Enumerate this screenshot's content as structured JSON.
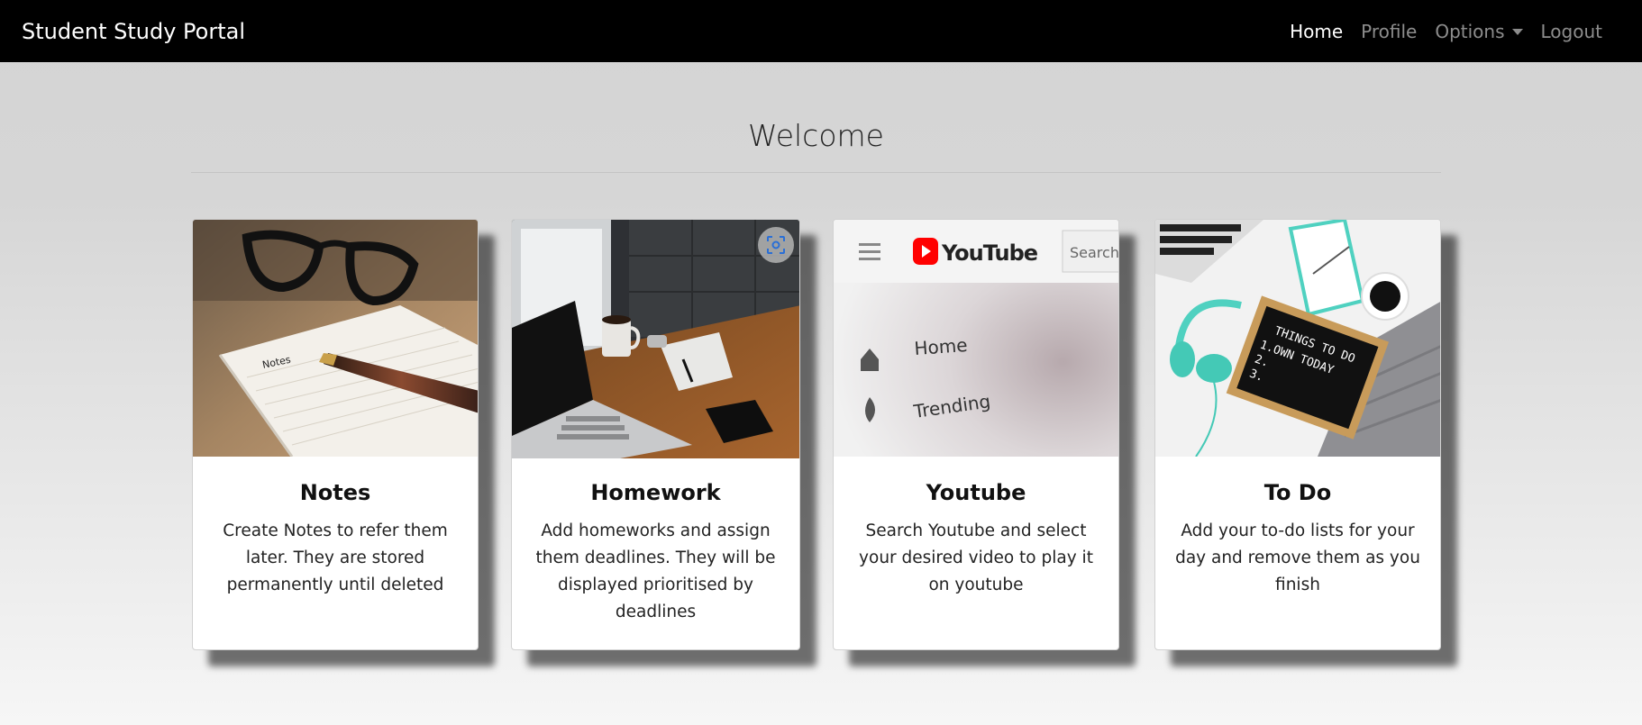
{
  "navbar": {
    "brand": "Student Study Portal",
    "links": [
      {
        "label": "Home",
        "active": true
      },
      {
        "label": "Profile",
        "active": false
      },
      {
        "label": "Options",
        "active": false,
        "dropdown": true
      },
      {
        "label": "Logout",
        "active": false
      }
    ]
  },
  "page": {
    "heading": "Welcome"
  },
  "cards": [
    {
      "title": "Notes",
      "text": "Create Notes to refer them later. They are stored permanently until deleted",
      "image": "notebook-pen-glasses-photo"
    },
    {
      "title": "Homework",
      "text": "Add homeworks and assign them deadlines. They will be displayed prioritised by deadlines",
      "image": "laptop-desk-coffee-photo"
    },
    {
      "title": "Youtube",
      "text": "Search Youtube and select your desired video to play it on youtube",
      "image": "youtube-screen-photo",
      "image_text": {
        "logo": "YouTube",
        "search": "Search",
        "menu_home": "Home",
        "menu_trending": "Trending"
      }
    },
    {
      "title": "To Do",
      "text": "Add your to-do lists for your day and remove them as you finish",
      "image": "todo-board-headphones-photo",
      "image_text": {
        "board_line1": "THINGS TO DO",
        "board_line2": "1.OWN TODAY",
        "board_line3": "2.",
        "board_line4": "3."
      }
    }
  ],
  "colors": {
    "navbar_bg": "#000000",
    "youtube_red": "#ff0000"
  }
}
